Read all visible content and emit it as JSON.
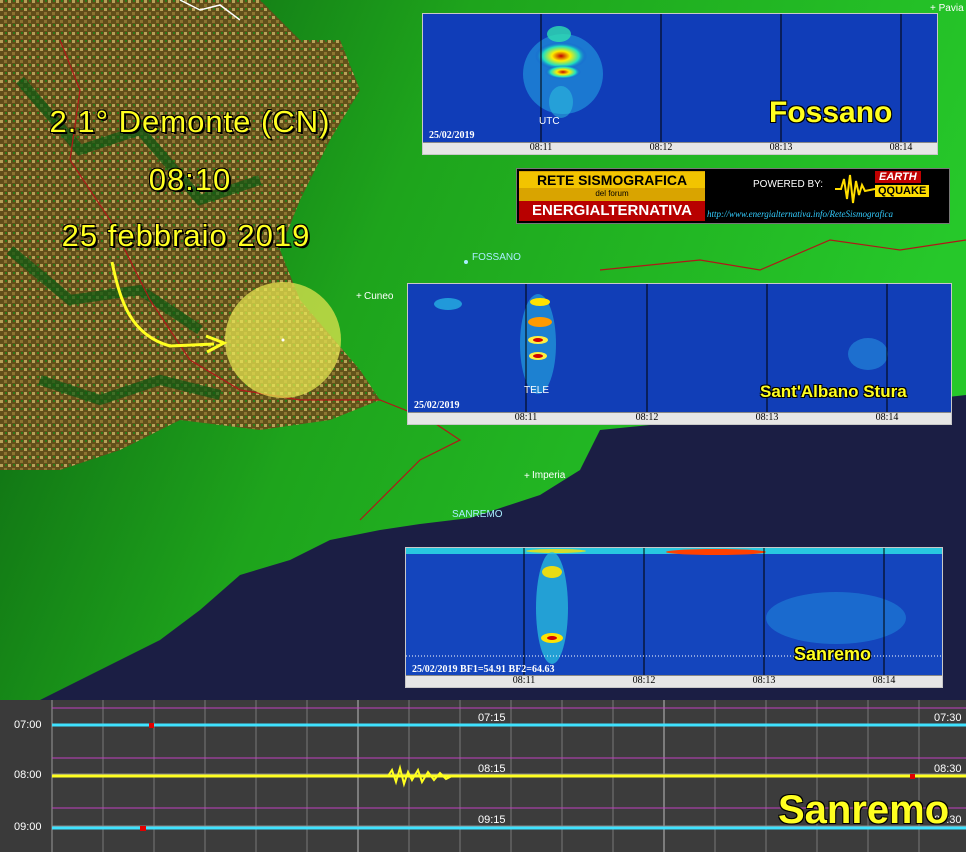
{
  "event": {
    "magnitude": "2.1° Demonte (CN)",
    "time": "08:10",
    "date": "25 febbraio 2019"
  },
  "towns": {
    "pavia": "Pavia",
    "fossano": "FOSSANO",
    "cuneo": "Cuneo",
    "imperia": "Imperia",
    "sanremo": "SANREMO"
  },
  "banner": {
    "title": "RETE SISMOGRAFICA",
    "subtitle": "del forum",
    "brand": "ENERGIALTERNATIVA",
    "powered": "POWERED BY:",
    "earth": "EARTH",
    "quake": "QQUAKE",
    "url": "http://www.energialternativa.info/ReteSismografica"
  },
  "spectrograms": [
    {
      "station": "Fossano",
      "date": "25/02/2019",
      "tag": "UTC",
      "ticks": [
        "08:11",
        "08:12",
        "08:13",
        "08:14"
      ]
    },
    {
      "station": "Sant'Albano Stura",
      "date": "25/02/2019",
      "tag": "TELE",
      "ticks": [
        "08:11",
        "08:12",
        "08:13",
        "08:14"
      ]
    },
    {
      "station": "Sanremo",
      "date": "25/02/2019 BF1=54.91 BF2=64.63",
      "tag": "",
      "ticks": [
        "08:11",
        "08:12",
        "08:13",
        "08:14"
      ]
    }
  ],
  "helicorder": {
    "station": "Sanremo",
    "rows": [
      {
        "label": "07:00",
        "mid": "07:15",
        "end": "07:30",
        "color": "#3fe2ff"
      },
      {
        "label": "08:00",
        "mid": "08:15",
        "end": "08:30",
        "color": "#ffff20"
      },
      {
        "label": "09:00",
        "mid": "09:15",
        "end": "09:30",
        "color": "#3fe2ff"
      }
    ]
  }
}
